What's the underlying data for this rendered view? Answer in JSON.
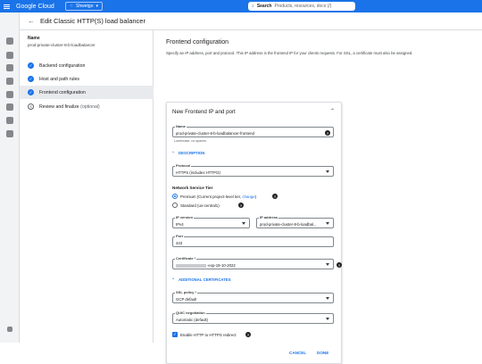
{
  "topbar": {
    "brand": "Google Cloud",
    "project": "Shwetgo",
    "search_label": "Search",
    "search_placeholder": "Products, resources, docs (/)"
  },
  "header": {
    "back_icon": "arrow-back-icon",
    "title": "Edit Classic HTTP(S) load balancer"
  },
  "left_panel": {
    "name_label": "Name",
    "name_value": "prod-private-cluster-8-b-loadbalancer",
    "steps": [
      {
        "label": "Backend configuration",
        "state": "done"
      },
      {
        "label": "Host and path rules",
        "state": "done"
      },
      {
        "label": "Frontend configuration",
        "state": "done"
      },
      {
        "label": "Review and finalize",
        "suffix": "(optional)",
        "state": "todo"
      }
    ]
  },
  "main": {
    "title": "Frontend configuration",
    "description": "Specify an IP address, port and protocol. This IP address is the frontend IP for your clients requests. For SSL, a certificate must also be assigned."
  },
  "card": {
    "heading": "New Frontend IP and port",
    "name_field": {
      "label": "Name",
      "value": "prod-private-cluster-8-b-loadbalancer-frontend",
      "hint": "Lowercase, no spaces."
    },
    "description_section": "DESCRIPTION",
    "protocol": {
      "label": "Protocol",
      "value": "HTTPS (includes HTTP/2)"
    },
    "network_tier": {
      "label": "Network Service Tier",
      "premium": "Premium (Current project-level tier,",
      "change_link": "change",
      "premium_close": ")",
      "standard": "Standard (us-central1)"
    },
    "ip_version": {
      "label": "IP version",
      "value": "IPv4"
    },
    "ip_address": {
      "label": "IP address",
      "value": "prod-private-cluster-8-b-loadbal..."
    },
    "port": {
      "label": "Port",
      "value": "443"
    },
    "certificate": {
      "label": "Certificate *",
      "value_suffix": "-exp-19-10-2022"
    },
    "additional_certs_section": "ADDITIONAL CERTIFICATES",
    "ssl_policy": {
      "label": "SSL policy *",
      "value": "GCP default"
    },
    "quic": {
      "label": "QUIC negotiation",
      "value": "Automatic (default)"
    },
    "redirect_label": "Enable HTTP to HTTPS redirect",
    "cancel": "CANCEL",
    "done": "DONE"
  },
  "colors": {
    "accent": "#1a73e8",
    "rail": "#f1f3f4"
  }
}
